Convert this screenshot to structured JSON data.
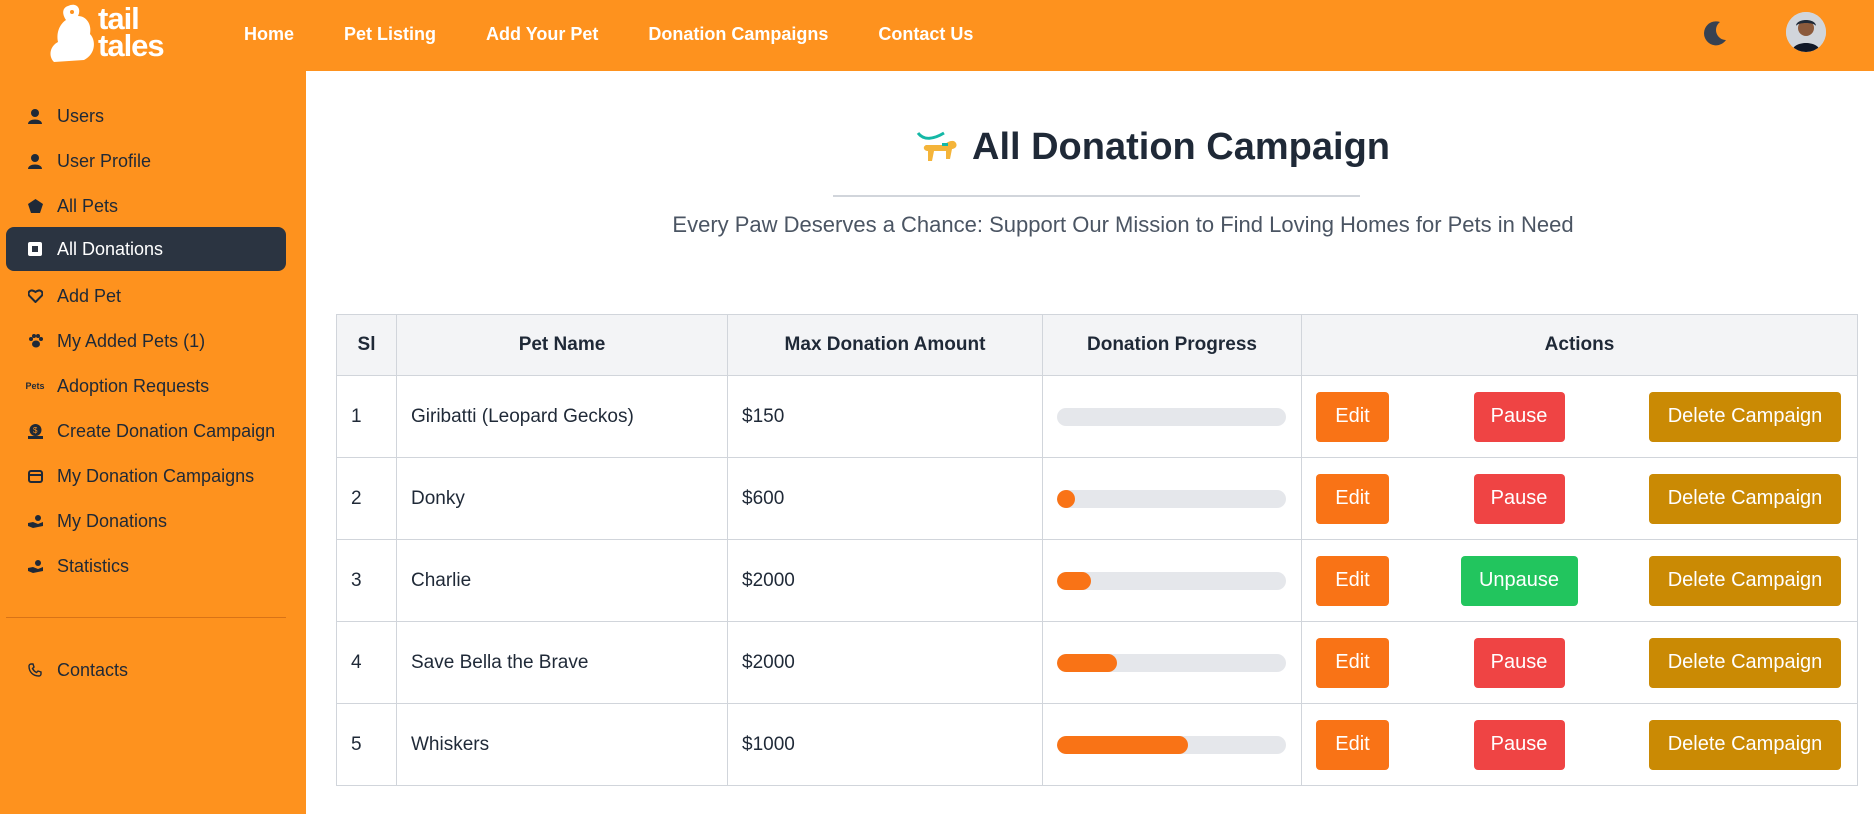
{
  "brand": {
    "logo_text_line1": "tail",
    "logo_text_line2": "tales"
  },
  "nav": {
    "items": [
      "Home",
      "Pet Listing",
      "Add Your Pet",
      "Donation Campaigns",
      "Contact Us"
    ]
  },
  "sidebar": {
    "items": [
      {
        "label": "Users",
        "icon": "user-icon"
      },
      {
        "label": "User Profile",
        "icon": "user-icon"
      },
      {
        "label": "All Pets",
        "icon": "pentagon-icon"
      },
      {
        "label": "All Donations",
        "icon": "donation-box-icon",
        "active": true
      },
      {
        "label": "Add Pet",
        "icon": "heart-plus-icon"
      },
      {
        "label": "My Added Pets (1)",
        "icon": "paw-icon"
      },
      {
        "label": "Adoption Requests",
        "icon": "pets-text-icon"
      },
      {
        "label": "Create Donation Campaign",
        "icon": "dollar-icon"
      },
      {
        "label": "My Donation Campaigns",
        "icon": "card-icon"
      },
      {
        "label": "My Donations",
        "icon": "hand-coin-icon"
      },
      {
        "label": "Statistics",
        "icon": "hand-coin-icon"
      }
    ],
    "contacts_label": "Contacts"
  },
  "page": {
    "title": "All Donation Campaign",
    "subtitle": "Every Paw Deserves a Chance: Support Our Mission to Find Loving Homes for Pets in Need"
  },
  "table": {
    "headers": [
      "Sl",
      "Pet Name",
      "Max Donation Amount",
      "Donation Progress",
      "Actions"
    ],
    "rows": [
      {
        "sl": "1",
        "name": "Giribatti (Leopard Geckos)",
        "max": "$150",
        "progress": 0.0,
        "edit": "Edit",
        "toggle": "Pause",
        "paused": false,
        "delete": "Delete Campaign"
      },
      {
        "sl": "2",
        "name": "Donky",
        "max": "$600",
        "progress": 0.08,
        "edit": "Edit",
        "toggle": "Pause",
        "paused": false,
        "delete": "Delete Campaign"
      },
      {
        "sl": "3",
        "name": "Charlie",
        "max": "$2000",
        "progress": 0.15,
        "edit": "Edit",
        "toggle": "Unpause",
        "paused": true,
        "delete": "Delete Campaign"
      },
      {
        "sl": "4",
        "name": "Save Bella the Brave",
        "max": "$2000",
        "progress": 0.26,
        "edit": "Edit",
        "toggle": "Pause",
        "paused": false,
        "delete": "Delete Campaign"
      },
      {
        "sl": "5",
        "name": "Whiskers",
        "max": "$1000",
        "progress": 0.57,
        "edit": "Edit",
        "toggle": "Pause",
        "paused": false,
        "delete": "Delete Campaign"
      }
    ]
  },
  "colors": {
    "primary": "#fe921e",
    "progress": "#f97316",
    "pause": "#ef4444",
    "unpause": "#22c55e",
    "delete": "#ca8a04",
    "active_sidebar": "#2b3441"
  }
}
